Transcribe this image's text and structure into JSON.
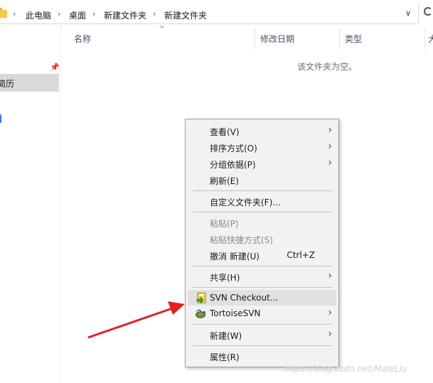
{
  "address_bar": {
    "breadcrumbs": [
      "此电脑",
      "桌面",
      "新建文件夹",
      "新建文件夹"
    ],
    "separator": "›",
    "dropdown": "∨"
  },
  "nav_pane": {
    "pin": "📌",
    "selected_item": "简历"
  },
  "columns": [
    "名称",
    "修改日期",
    "类型",
    "大"
  ],
  "sort_indicator": "^",
  "empty_message": "该文件夹为空。",
  "context_menu": {
    "items": [
      {
        "label": "查看(V)",
        "submenu": true
      },
      {
        "label": "排序方式(O)",
        "submenu": true
      },
      {
        "label": "分组依据(P)",
        "submenu": true
      },
      {
        "label": "刷新(E)",
        "submenu": false
      },
      {
        "label": "自定义文件夹(F)...",
        "submenu": false
      },
      {
        "label": "粘贴(P)",
        "disabled": true
      },
      {
        "label": "粘贴快捷方式(S)",
        "disabled": true
      },
      {
        "label": "撤消 新建(U)",
        "shortcut": "Ctrl+Z"
      },
      {
        "label": "共享(H)",
        "submenu": true
      },
      {
        "label": "SVN Checkout...",
        "icon": "svn-checkout-icon",
        "highlighted": true
      },
      {
        "label": "TortoiseSVN",
        "icon": "tortoise-svn-icon",
        "submenu": true
      },
      {
        "label": "新建(W)",
        "submenu": true
      },
      {
        "label": "属性(R)",
        "submenu": false
      }
    ],
    "chevron": "›"
  },
  "annotation": {
    "arrow_color": "#e02020"
  },
  "watermark": "https://blog.csdn.net/MaleLiu"
}
